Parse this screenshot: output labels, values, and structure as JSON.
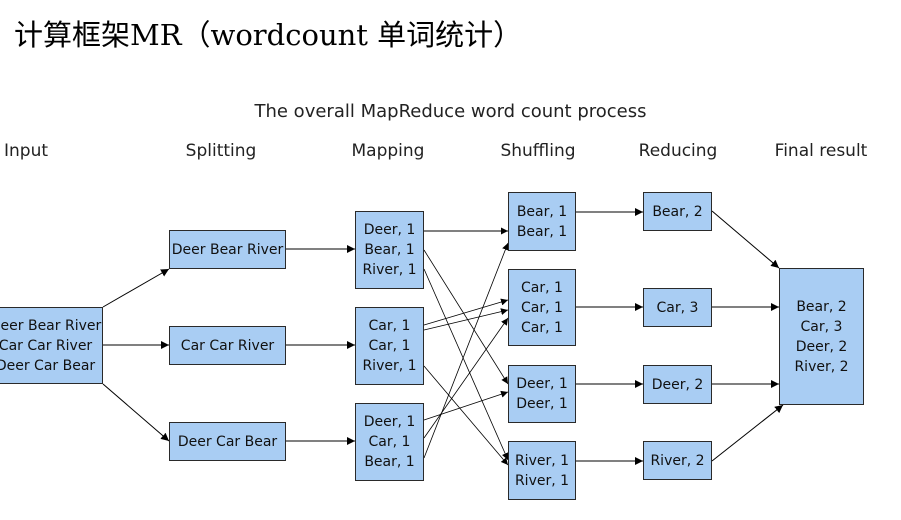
{
  "slide_title": "计算框架MR（wordcount 单词统计）",
  "figure_title": "The overall MapReduce word count process",
  "stages": [
    "Input",
    "Splitting",
    "Mapping",
    "Shuffling",
    "Reducing",
    "Final result"
  ],
  "input": [
    "Deer Bear River",
    "Car Car River",
    "Deer Car Bear"
  ],
  "splits": [
    "Deer Bear River",
    "Car Car River",
    "Deer Car Bear"
  ],
  "mapping": [
    [
      "Deer, 1",
      "Bear, 1",
      "River, 1"
    ],
    [
      "Car, 1",
      "Car, 1",
      "River, 1"
    ],
    [
      "Deer, 1",
      "Car, 1",
      "Bear, 1"
    ]
  ],
  "shuffling": [
    [
      "Bear, 1",
      "Bear, 1"
    ],
    [
      "Car, 1",
      "Car, 1",
      "Car, 1"
    ],
    [
      "Deer, 1",
      "Deer, 1"
    ],
    [
      "River, 1",
      "River, 1"
    ]
  ],
  "reducing": [
    "Bear, 2",
    "Car, 3",
    "Deer, 2",
    "River, 2"
  ],
  "final_result": [
    "Bear, 2",
    "Car, 3",
    "Deer, 2",
    "River, 2"
  ],
  "colors": {
    "box_fill": "#a9cdf3",
    "box_border": "#2a2a2a",
    "arrow": "#000000"
  }
}
